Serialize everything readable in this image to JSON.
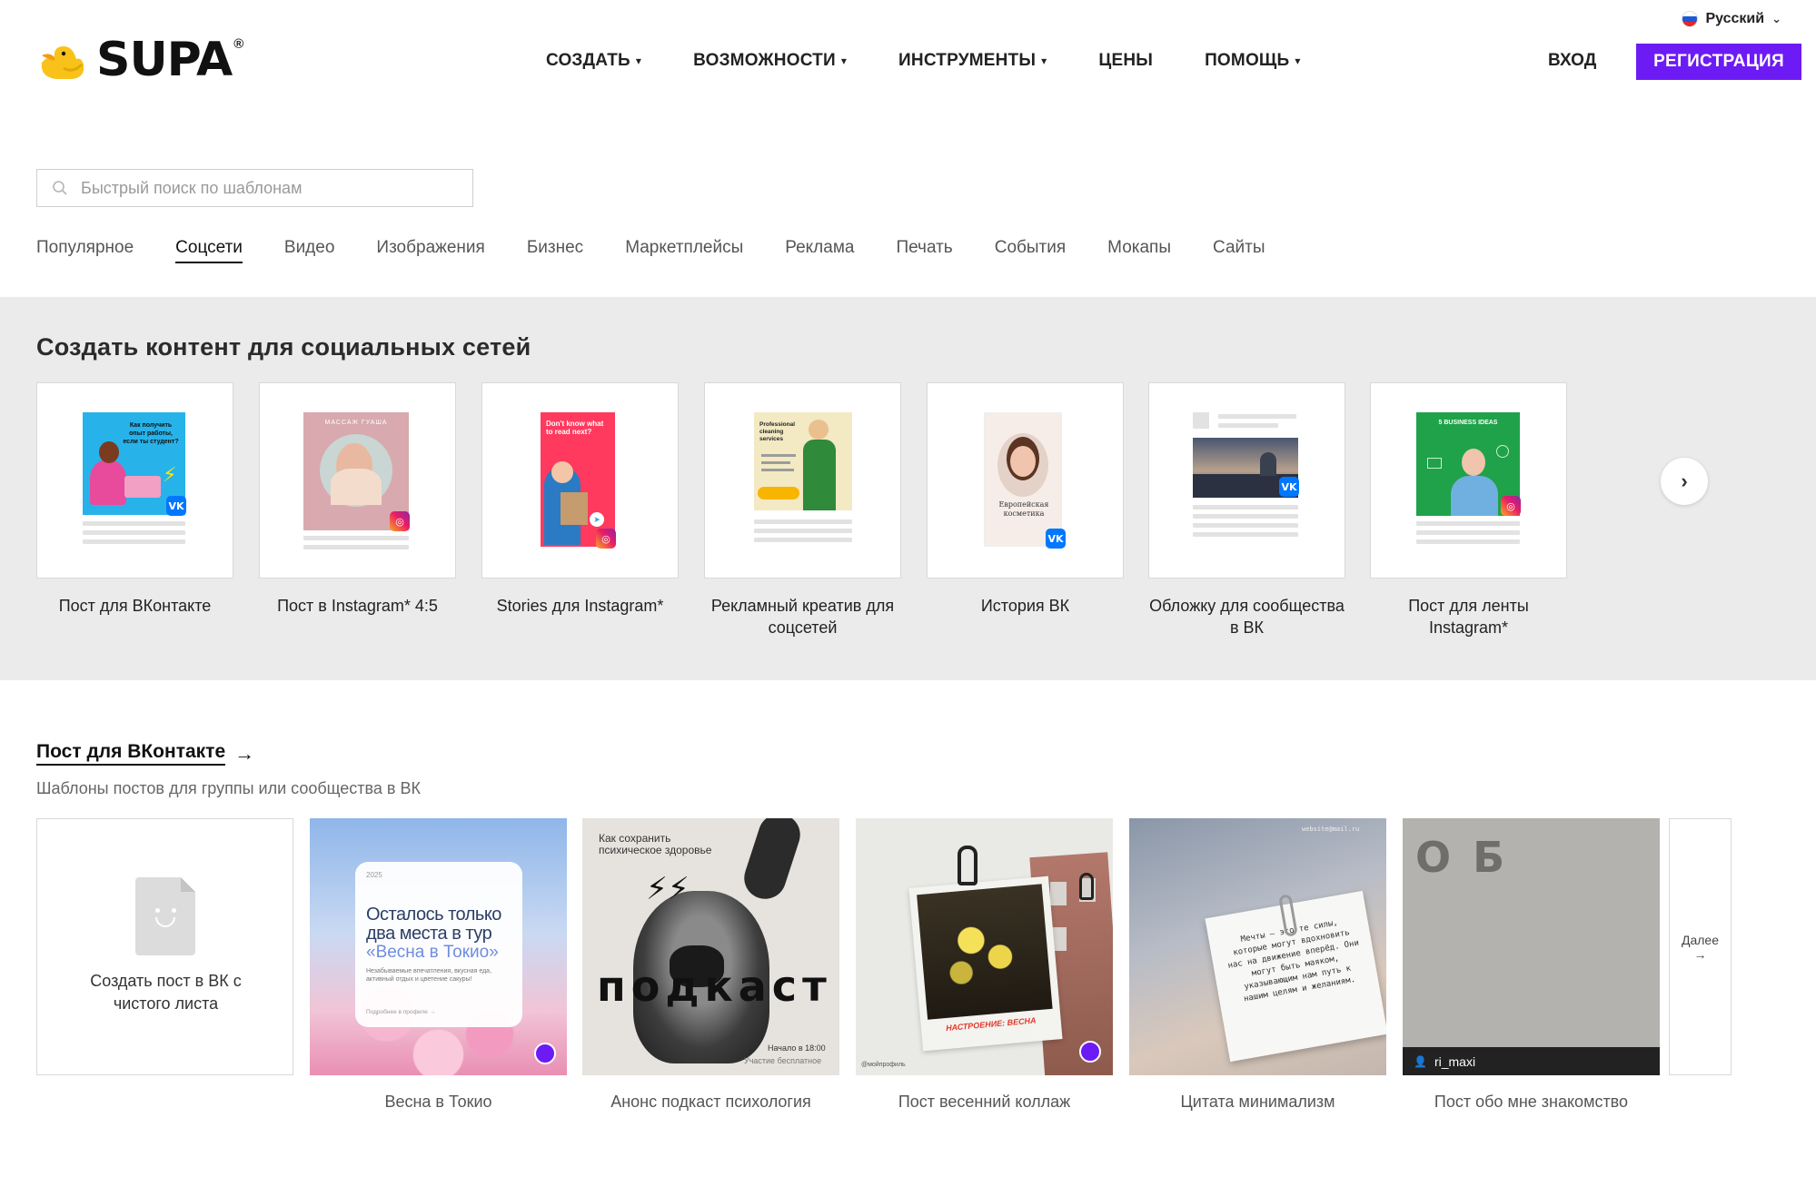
{
  "header": {
    "language": "Русский",
    "logo_text": "SUPA",
    "logo_reg": "®",
    "nav": [
      {
        "label": "СОЗДАТЬ",
        "dropdown": true
      },
      {
        "label": "ВОЗМОЖНОСТИ",
        "dropdown": true
      },
      {
        "label": "ИНСТРУМЕНТЫ",
        "dropdown": true
      },
      {
        "label": "ЦЕНЫ",
        "dropdown": false
      },
      {
        "label": "ПОМОЩЬ",
        "dropdown": true
      }
    ],
    "login": "ВХОД",
    "signup": "РЕГИСТРАЦИЯ"
  },
  "search": {
    "placeholder": "Быстрый поиск по шаблонам"
  },
  "categories": {
    "items": [
      "Популярное",
      "Соцсети",
      "Видео",
      "Изображения",
      "Бизнес",
      "Маркетплейсы",
      "Реклама",
      "Печать",
      "События",
      "Мокапы",
      "Сайты"
    ],
    "active": "Соцсети"
  },
  "social_section": {
    "title": "Создать контент для социальных сетей",
    "cards": [
      {
        "label": "Пост для ВКонтакте",
        "network": "vk",
        "thumb_text": "Как получить опыт работы, если ты студент?"
      },
      {
        "label": "Пост в Instagram* 4:5",
        "network": "instagram",
        "thumb_text": "МАССАЖ ГУАША"
      },
      {
        "label": "Stories для Instagram*",
        "network": "instagram",
        "thumb_text": "Don't know what to read next?"
      },
      {
        "label": "Рекламный креатив для соцсетей",
        "network": "none",
        "thumb_text": "Professional cleaning services"
      },
      {
        "label": "История ВК",
        "network": "vk",
        "thumb_text": "Европейская косметика"
      },
      {
        "label": "Обложку для сообщества в ВК",
        "network": "vk",
        "thumb_text": ""
      },
      {
        "label": "Пост для ленты Instagram*",
        "network": "instagram",
        "thumb_text": "5 BUSINESS IDEAS"
      }
    ]
  },
  "vk_section": {
    "title": "Пост для ВКонтакте",
    "subtitle": "Шаблоны постов для группы или сообщества в ВК",
    "blank_label": "Создать пост в ВК с чистого листа",
    "more_label": "Далее",
    "templates": [
      {
        "label": "Весна в Токио",
        "text": "Осталось только два места в тур",
        "highlight": "«Весна в Токио»",
        "small": "Незабываемые впечатления, вкусная еда, активный отдых и цветение сакуры!",
        "year": "2025",
        "cta": "Подробнее в профиле →"
      },
      {
        "label": "Анонс подкаст психология",
        "text": "Как сохранить психическое здоровье",
        "word": "подкаст",
        "time": "Начало в 18:00",
        "note": "Участие бесплатное"
      },
      {
        "label": "Пост весенний коллаж",
        "caption": "НАСТРОЕНИЕ: ВЕСНА",
        "handle": "@мойпрофиль"
      },
      {
        "label": "Цитата минимализм",
        "quote": "Мечты – это те силы, которые могут вдохновить нас на движение вперёд. Они могут быть маяком, указывающим нам путь к нашим целям и желаниям.",
        "site": "website@mail.ru"
      },
      {
        "label": "Пост обо мне знакомство",
        "heading": "О Б",
        "user": "ri_maxi"
      }
    ]
  },
  "colors": {
    "accent": "#6d1bf5",
    "vk": "#0077ff",
    "band": "#ebebeb"
  }
}
